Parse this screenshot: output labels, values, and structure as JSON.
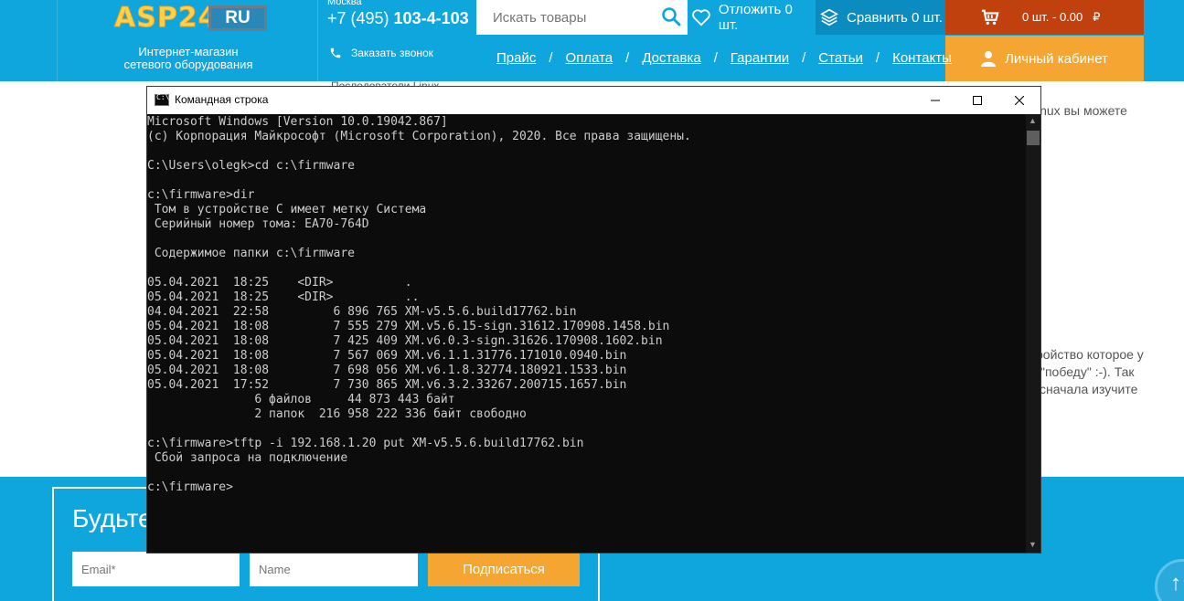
{
  "site": {
    "logo_text": "ASP24",
    "logo_badge": "RU",
    "tagline_line1": "Интернет-магазин",
    "tagline_line2": "сетевого оборудования",
    "phone_city": "Москва",
    "phone_prefix": "+7 (495) ",
    "phone_number": "103-4-103",
    "callback_label": "Заказать звонок",
    "search_placeholder": "Искать товары",
    "defer_label": "Отложить 0 шт.",
    "compare_label": "Сравнить 0 шт.",
    "cart_label": "0 шт. - 0.00",
    "currency": "₽",
    "cabinet_label": "Личный кабинет",
    "nav": [
      "Прайс",
      "Оплата",
      "Доставка",
      "Гарантии",
      "Статьи",
      "Контакты"
    ],
    "nav_separator": "/"
  },
  "page": {
    "partial_top": "Последователи Linux",
    "partial_right1": "inux  вы  можете",
    "partial_right2": "ройство которое у",
    "partial_right3": "\"победу\" :-). Так",
    "partial_right4": "сначала изучите"
  },
  "subscribe": {
    "title": "Будьте",
    "email_placeholder": "Email*",
    "name_placeholder": "Name",
    "button_label": "Подписаться"
  },
  "cmd": {
    "title": "Командная строка",
    "icon_text": "C:\\",
    "lines": [
      "Microsoft Windows [Version 10.0.19042.867]",
      "(c) Корпорация Майкрософт (Microsoft Corporation), 2020. Все права защищены.",
      "",
      "C:\\Users\\olegk>cd c:\\firmware",
      "",
      "c:\\firmware>dir",
      " Том в устройстве C имеет метку Система",
      " Серийный номер тома: EA70-764D",
      "",
      " Содержимое папки c:\\firmware",
      "",
      "05.04.2021  18:25    <DIR>          .",
      "05.04.2021  18:25    <DIR>          ..",
      "04.04.2021  22:58         6 896 765 XM-v5.5.6.build17762.bin",
      "05.04.2021  18:08         7 555 279 XM.v5.6.15-sign.31612.170908.1458.bin",
      "05.04.2021  18:08         7 425 409 XM.v6.0.3-sign.31626.170908.1602.bin",
      "05.04.2021  18:08         7 567 069 XM.v6.1.1.31776.171010.0940.bin",
      "05.04.2021  18:08         7 698 056 XM.v6.1.8.32774.180921.1533.bin",
      "05.04.2021  17:52         7 730 865 XM.v6.3.2.33267.200715.1657.bin",
      "               6 файлов     44 873 443 байт",
      "               2 папок  216 958 222 336 байт свободно",
      "",
      "c:\\firmware>tftp -i 192.168.1.20 put XM-v5.5.6.build17762.bin",
      " Сбой запроса на подключение",
      "",
      "c:\\firmware>"
    ]
  },
  "colors": {
    "site_blue": "#0fa5dd",
    "cart_red": "#c0410e",
    "accent_orange": "#f5a532",
    "terminal_bg": "#0c0c0c",
    "terminal_text": "#cccccc"
  }
}
